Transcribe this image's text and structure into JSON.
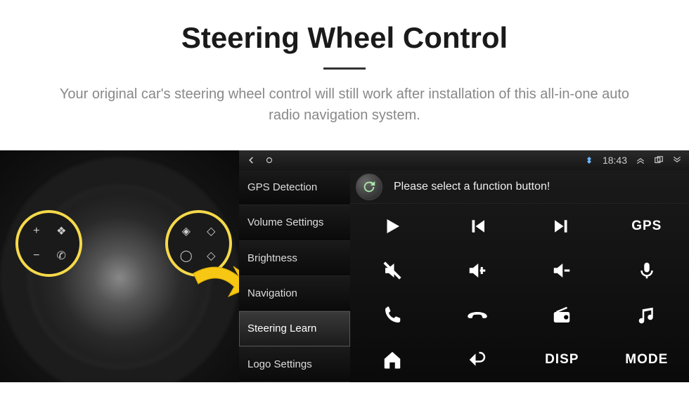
{
  "header": {
    "title": "Steering Wheel Control",
    "subtitle": "Your original car's steering wheel control will still work after installation of this all-in-one auto radio navigation system."
  },
  "statusbar": {
    "time": "18:43"
  },
  "sidebar": {
    "items": [
      {
        "label": "GPS Detection",
        "active": false
      },
      {
        "label": "Volume Settings",
        "active": false
      },
      {
        "label": "Brightness",
        "active": false
      },
      {
        "label": "Navigation",
        "active": false
      },
      {
        "label": "Steering Learn",
        "active": true
      },
      {
        "label": "Logo Settings",
        "active": false
      }
    ]
  },
  "instruction": "Please select a function button!",
  "grid": {
    "buttons": [
      {
        "name": "play-icon"
      },
      {
        "name": "prev-track-icon"
      },
      {
        "name": "next-track-icon"
      },
      {
        "name": "gps-text",
        "text": "GPS"
      },
      {
        "name": "mute-icon"
      },
      {
        "name": "vol-up-icon"
      },
      {
        "name": "vol-down-icon"
      },
      {
        "name": "mic-icon"
      },
      {
        "name": "phone-icon"
      },
      {
        "name": "hangup-icon"
      },
      {
        "name": "radio-icon"
      },
      {
        "name": "music-icon"
      },
      {
        "name": "home-icon"
      },
      {
        "name": "back-icon"
      },
      {
        "name": "disp-text",
        "text": "DISP"
      },
      {
        "name": "mode-text",
        "text": "MODE"
      }
    ]
  }
}
